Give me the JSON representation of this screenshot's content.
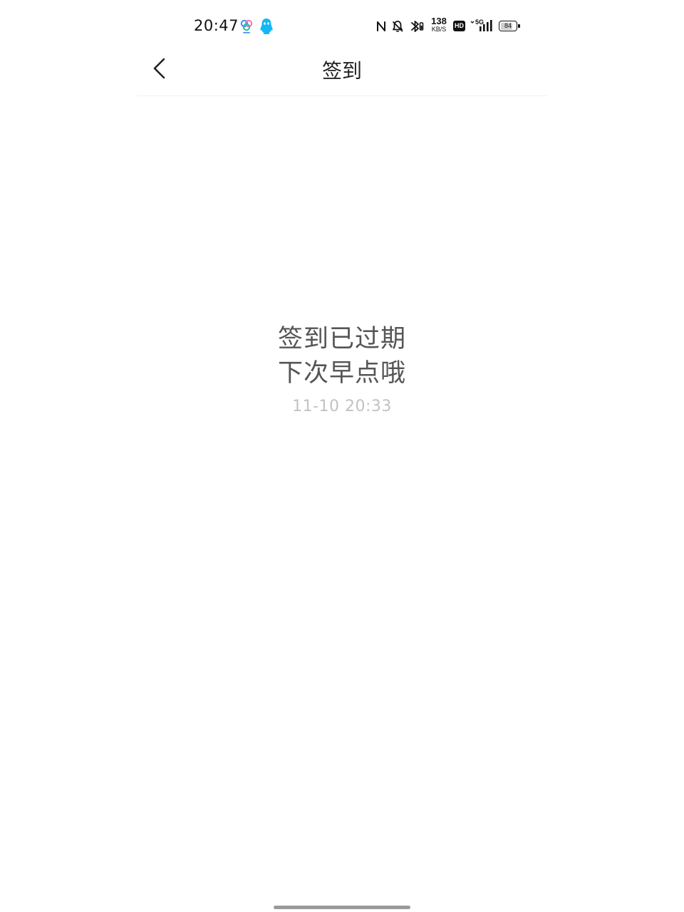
{
  "status_bar": {
    "time": "20:47",
    "net_speed_value": "138",
    "net_speed_unit": "KB/S",
    "hd_label": "HD",
    "network_type": "5G",
    "battery_level": "84",
    "battery_fraction": 0.84,
    "qq_color": "#12b7f5",
    "app_icon_colors": [
      "#3d8bff",
      "#ff6fae",
      "#19c3a0"
    ]
  },
  "nav": {
    "title": "签到"
  },
  "message": {
    "line1": "签到已过期",
    "line2": "下次早点哦",
    "timestamp": "11-10 20:33"
  }
}
